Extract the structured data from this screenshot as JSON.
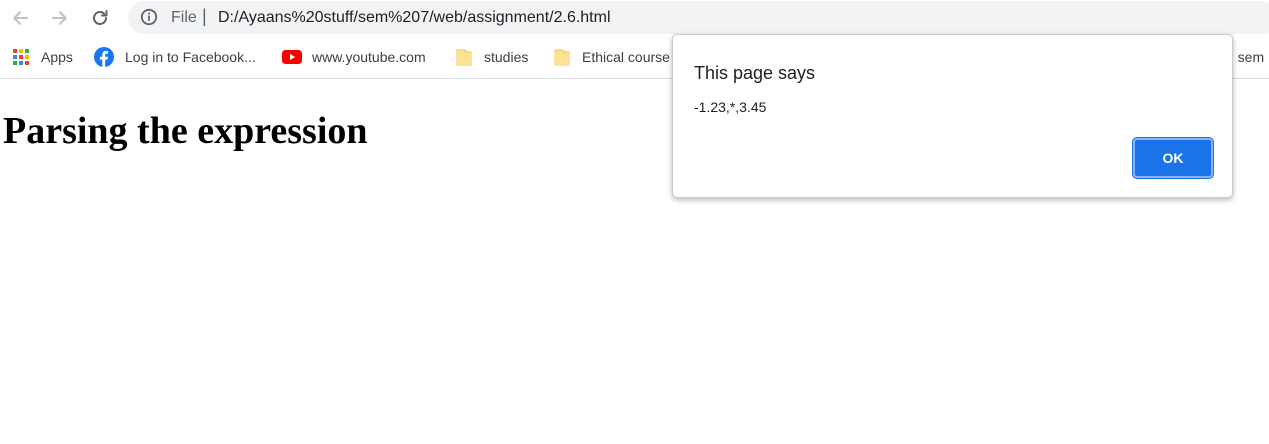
{
  "toolbar": {
    "back_icon": "arrow-left-icon",
    "forward_icon": "arrow-right-icon",
    "reload_icon": "reload-icon",
    "info_icon": "info-icon",
    "scheme_label": "File",
    "separator": "|",
    "url": "D:/Ayaans%20stuff/sem%207/web/assignment/2.6.html"
  },
  "bookmarks": {
    "items": [
      {
        "label": "Apps",
        "icon": "apps-grid-icon"
      },
      {
        "label": "Log in to Facebook...",
        "icon": "facebook-icon"
      },
      {
        "label": "www.youtube.com",
        "icon": "youtube-icon"
      },
      {
        "label": "studies",
        "icon": "folder-icon"
      },
      {
        "label": "Ethical course",
        "icon": "folder-icon"
      }
    ],
    "clipped_label": "h sem"
  },
  "page": {
    "heading": "Parsing the expression"
  },
  "dialog": {
    "title": "This page says",
    "message": "-1.23,*,3.45",
    "ok_label": "OK"
  },
  "colors": {
    "accent": "#1a73e8",
    "omnibox_bg": "#f1f3f4",
    "youtube_red": "#ff0000",
    "facebook_blue": "#1877f2",
    "folder_yellow": "#fde293"
  }
}
